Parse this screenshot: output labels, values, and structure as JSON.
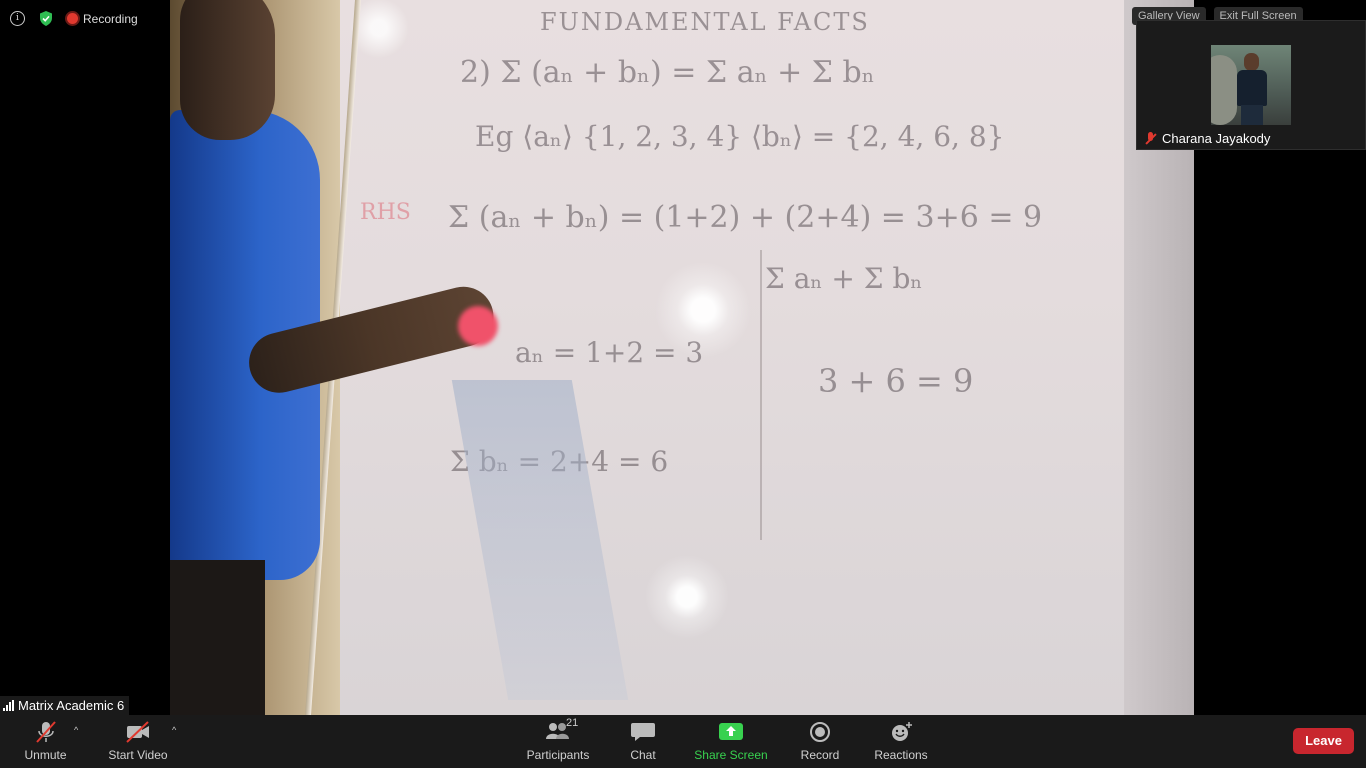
{
  "app": "Zoom Meeting",
  "top_bar": {
    "info_icon": "info-icon",
    "security_icon": "shield-check-icon",
    "recording_label": "Recording"
  },
  "self_view": {
    "header_left": "Gallery View",
    "header_right": "Exit Full Screen",
    "participant_name": "Charana Jayakody"
  },
  "main_video": {
    "speaker_label": "Matrix Academic 6",
    "board_lines": [
      "FUNDAMENTAL FACTS",
      "2)  Σ (aₙ + bₙ)  =  Σ aₙ  +  Σ bₙ",
      "Eg  ⟨aₙ⟩ {1, 2, 3, 4}    ⟨bₙ⟩ = {2, 4, 6, 8}",
      "RHS",
      "Σ (aₙ + bₙ) = (1+2) + (2+4) = 3+6 = 9",
      "Σ aₙ  +  Σ bₙ",
      "aₙ = 1+2 = 3",
      "3  +  6  =  9",
      "Σ bₙ = 2+4 = 6"
    ]
  },
  "toolbar": {
    "unmute_label": "Unmute",
    "start_video_label": "Start Video",
    "participants_label": "Participants",
    "participants_count": "21",
    "chat_label": "Chat",
    "share_label": "Share Screen",
    "record_label": "Record",
    "reactions_label": "Reactions",
    "leave_label": "Leave",
    "colors": {
      "leave": "#c8262e",
      "share": "#38d14f",
      "muted": "#e0392f"
    }
  }
}
